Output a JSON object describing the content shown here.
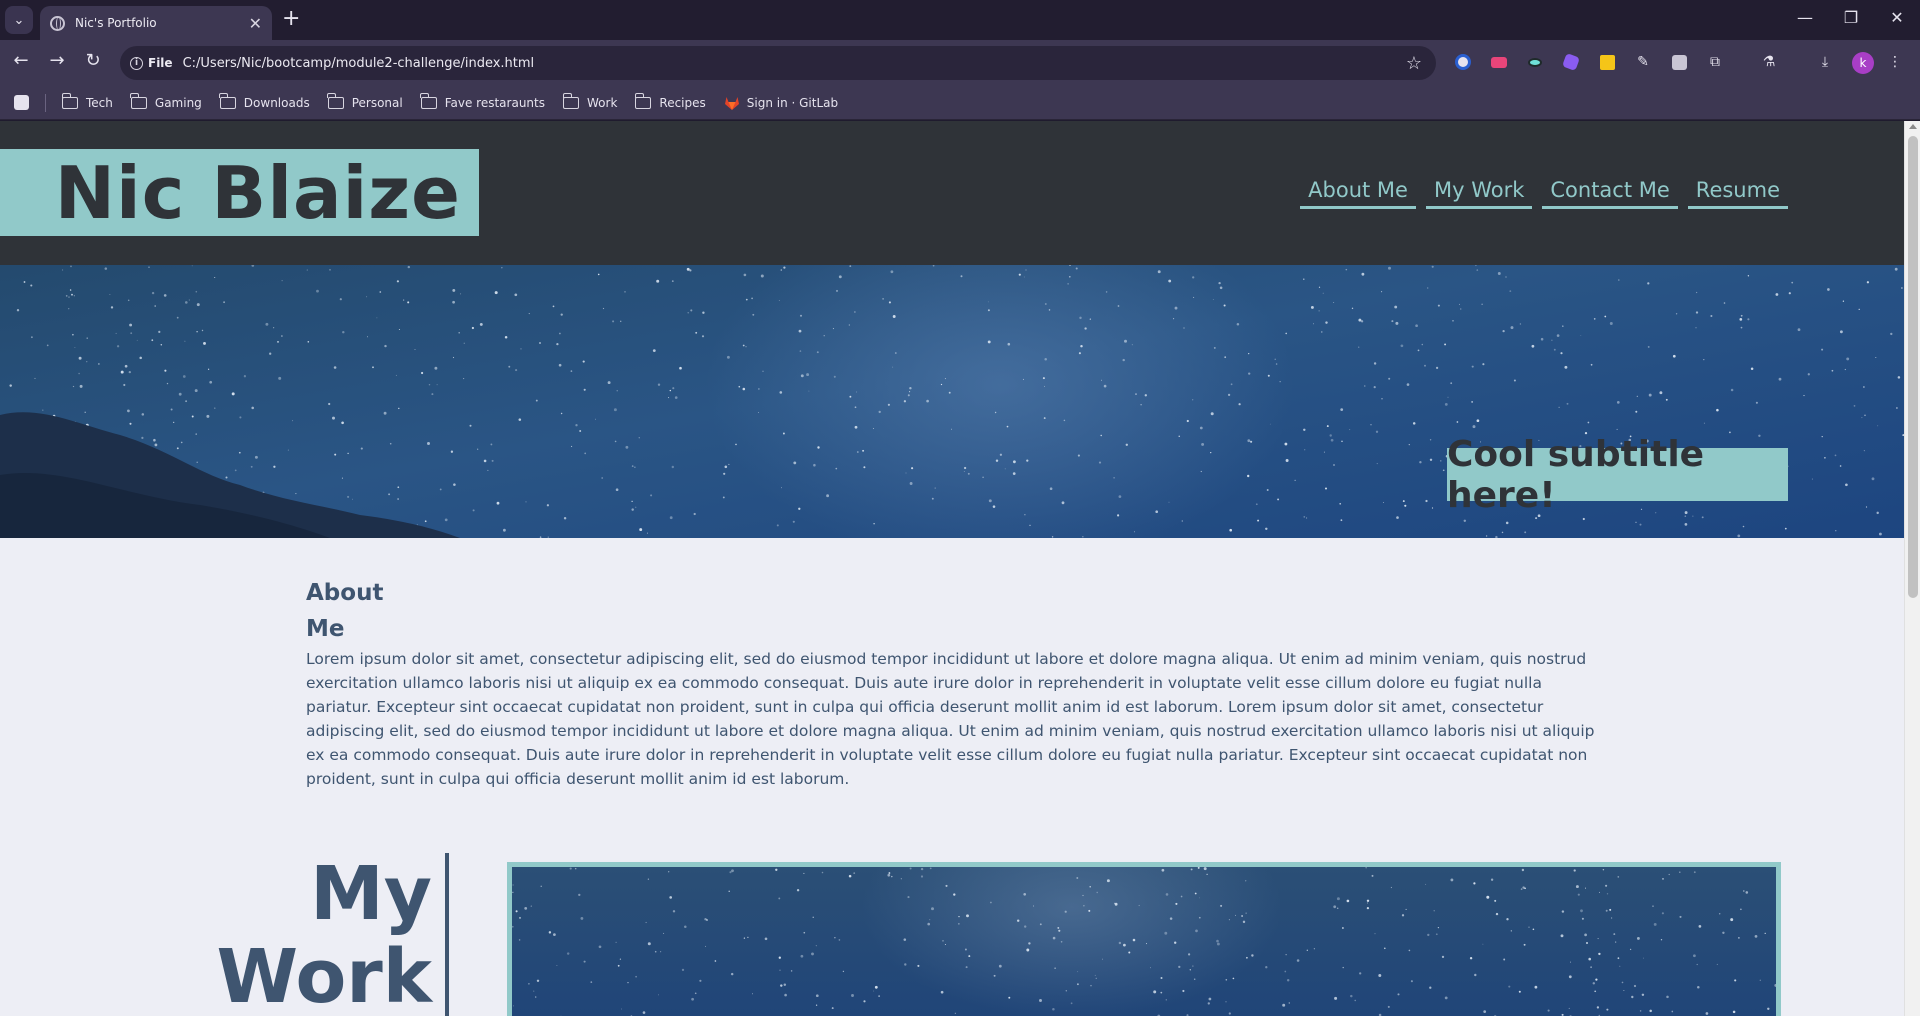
{
  "browser": {
    "tab_title": "Nic's Portfolio",
    "url_chip": "File",
    "url": "C:/Users/Nic/bootcamp/module2-challenge/index.html",
    "profile_initial": "k",
    "bookmarks": [
      {
        "label": "Tech"
      },
      {
        "label": "Gaming"
      },
      {
        "label": "Downloads"
      },
      {
        "label": "Personal"
      },
      {
        "label": "Fave restaraunts"
      },
      {
        "label": "Work"
      },
      {
        "label": "Recipes"
      },
      {
        "label": "Sign in · GitLab"
      }
    ]
  },
  "site": {
    "logo": "Nic Blaize",
    "nav": [
      {
        "label": "About Me"
      },
      {
        "label": "My Work"
      },
      {
        "label": "Contact Me"
      },
      {
        "label": "Resume"
      }
    ],
    "hero_subtitle": "Cool subtitle here!",
    "about": {
      "heading": "About Me",
      "body": "Lorem ipsum dolor sit amet, consectetur adipiscing elit, sed do eiusmod tempor incididunt ut labore et dolore magna aliqua. Ut enim ad minim veniam, quis nostrud exercitation ullamco laboris nisi ut aliquip ex ea commodo consequat. Duis aute irure dolor in reprehenderit in voluptate velit esse cillum dolore eu fugiat nulla pariatur. Excepteur sint occaecat cupidatat non proident, sunt in culpa qui officia deserunt mollit anim id est laborum. Lorem ipsum dolor sit amet, consectetur adipiscing elit, sed do eiusmod tempor incididunt ut labore et dolore magna aliqua. Ut enim ad minim veniam, quis nostrud exercitation ullamco laboris nisi ut aliquip ex ea commodo consequat. Duis aute irure dolor in reprehenderit in voluptate velit esse cillum dolore eu fugiat nulla pariatur. Excepteur sint occaecat cupidatat non proident, sunt in culpa qui officia deserunt mollit anim id est laborum."
    },
    "work_heading": "My Work"
  },
  "colors": {
    "accent": "#91c9c9",
    "header_bg": "#2f3338",
    "text": "#3f5570",
    "page_bg": "#edeef5"
  }
}
